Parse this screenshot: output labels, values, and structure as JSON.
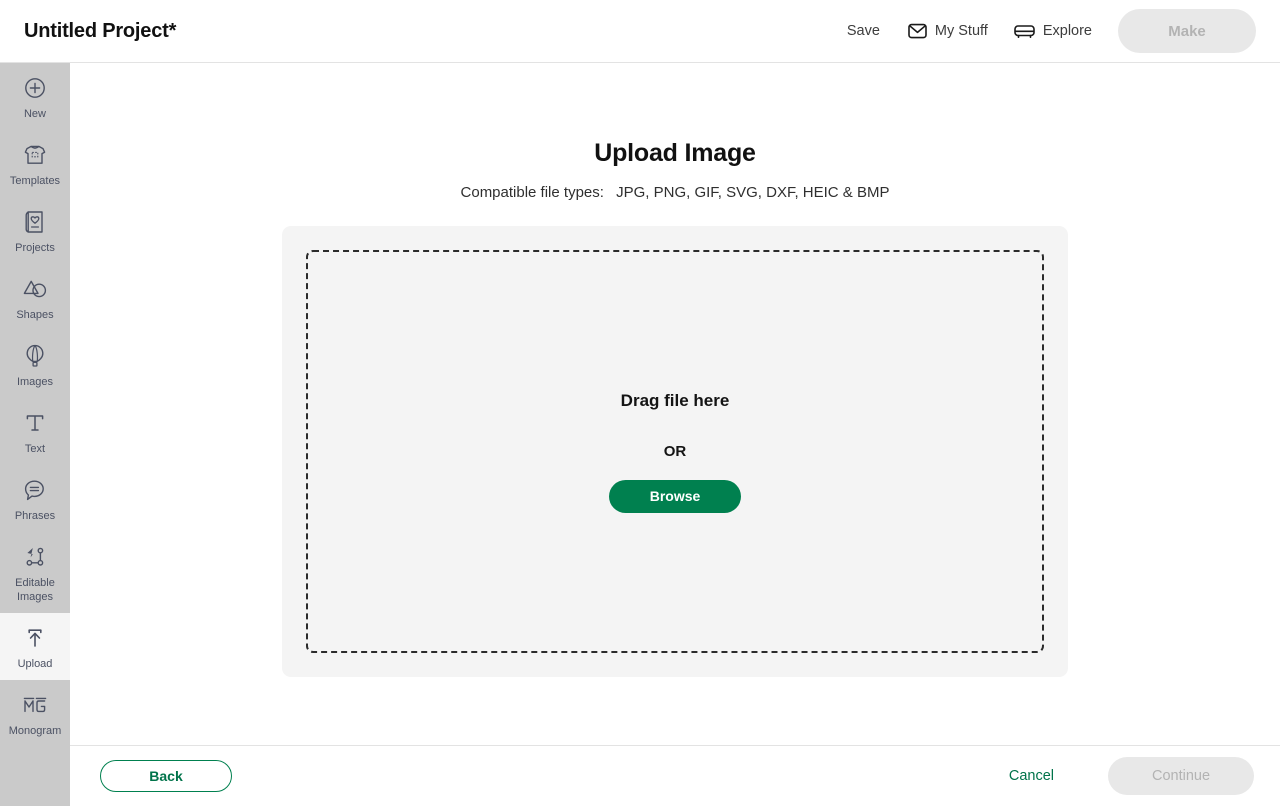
{
  "header": {
    "project_title": "Untitled Project*",
    "save_label": "Save",
    "my_stuff_label": "My Stuff",
    "my_stuff_icon": "envelope-icon",
    "explore_label": "Explore",
    "explore_icon": "cutting-machine-icon",
    "make_label": "Make",
    "make_disabled": true
  },
  "sidebar": {
    "items": [
      {
        "label": "New",
        "icon": "plus-circle-icon",
        "active": false
      },
      {
        "label": "Templates",
        "icon": "tshirt-icon",
        "active": false
      },
      {
        "label": "Projects",
        "icon": "card-heart-icon",
        "active": false
      },
      {
        "label": "Shapes",
        "icon": "shapes-icon",
        "active": false
      },
      {
        "label": "Images",
        "icon": "hot-air-balloon-icon",
        "active": false
      },
      {
        "label": "Text",
        "icon": "text-t-icon",
        "active": false
      },
      {
        "label": "Phrases",
        "icon": "speech-bubble-icon",
        "active": false
      },
      {
        "label": "Editable Images",
        "icon": "node-path-icon",
        "active": false
      },
      {
        "label": "Upload",
        "icon": "upload-arrow-icon",
        "active": true
      },
      {
        "label": "Monogram",
        "icon": "monogram-mg-icon",
        "active": false
      }
    ]
  },
  "main": {
    "title": "Upload Image",
    "compatible_label": "Compatible file types:",
    "compatible_types": "JPG, PNG, GIF, SVG, DXF, HEIC & BMP",
    "dropzone": {
      "drag_text": "Drag file here",
      "or_text": "OR",
      "browse_label": "Browse"
    }
  },
  "footer": {
    "back_label": "Back",
    "cancel_label": "Cancel",
    "continue_label": "Continue",
    "continue_disabled": true
  },
  "colors": {
    "brand_green": "#00804f",
    "brand_green_text": "#00734a",
    "sidebar_bg": "#cacaca",
    "dropzone_bg": "#f4f4f4",
    "disabled_bg": "#e8e8e8",
    "disabled_text": "#b3b3b3"
  }
}
